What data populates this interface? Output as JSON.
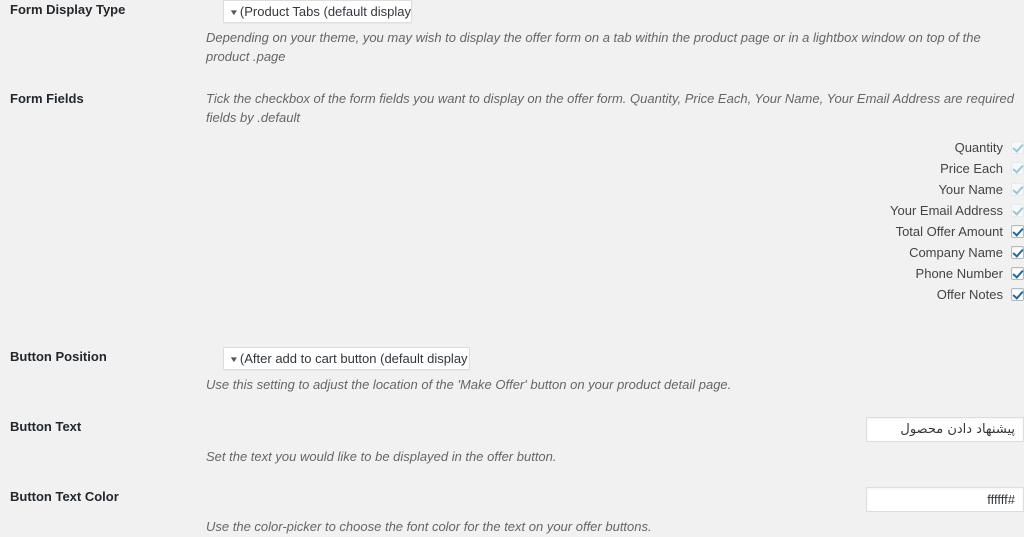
{
  "page": {
    "background_color": "#f1f1f1",
    "direction": "rtl"
  },
  "rows": {
    "form_display_type": {
      "label": "Form Display Type",
      "select_value": "(Product Tabs (default display",
      "select_arrow_icon": "chevron-down-icon",
      "description": "Depending on your theme, you may wish to display the offer form on a tab within the product page or in a lightbox window on top of the product .page"
    },
    "form_fields": {
      "label": "Form Fields",
      "description": "Tick the checkbox of the form fields you want to display on the offer form. Quantity, Price Each, Your Name, Your Email Address are required fields by .default",
      "items": [
        {
          "label": "Quantity",
          "checked": true,
          "enabled": false
        },
        {
          "label": "Price Each",
          "checked": true,
          "enabled": false
        },
        {
          "label": "Your Name",
          "checked": true,
          "enabled": false
        },
        {
          "label": "Your Email Address",
          "checked": true,
          "enabled": false
        },
        {
          "label": "Total Offer Amount",
          "checked": true,
          "enabled": true
        },
        {
          "label": "Company Name",
          "checked": true,
          "enabled": true
        },
        {
          "label": "Phone Number",
          "checked": true,
          "enabled": true
        },
        {
          "label": "Offer Notes",
          "checked": true,
          "enabled": true
        }
      ]
    },
    "button_position": {
      "label": "Button Position",
      "select_value": "(After add to cart button (default display",
      "select_arrow_icon": "chevron-down-icon",
      "description": ".Use this setting to adjust the location of the 'Make Offer' button on your product detail page"
    },
    "button_text": {
      "label": "Button Text",
      "input_value": "پیشنهاد دادن محصول",
      "input_placeholder": "",
      "description": ".Set the text you would like to be displayed in the offer button"
    },
    "button_text_color": {
      "label": "Button Text Color",
      "input_value": "#ffffff",
      "input_placeholder": "",
      "description": ".Use the color-picker to choose the font color for the text on your offer buttons"
    }
  }
}
